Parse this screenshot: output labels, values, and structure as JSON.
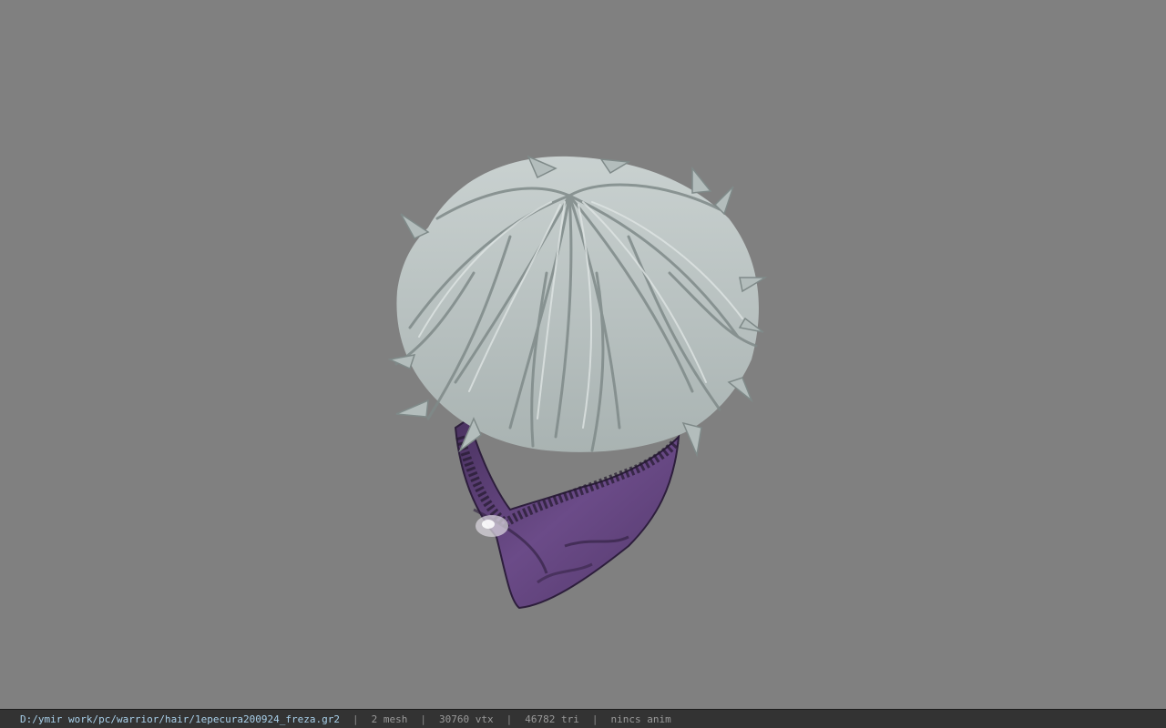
{
  "viewer": {
    "background_color": "#808080",
    "model": {
      "description_icon": "hair-model-icon",
      "hair_color": "#b8c2c1",
      "band_color": "#5a3f73"
    }
  },
  "statusbar": {
    "file_path": "D:/ymir work/pc/warrior/hair/1epecura200924_freza.gr2",
    "separator": "|",
    "mesh_count": "2 mesh",
    "vertex_count": "30760 vtx",
    "triangle_count": "46782 tri",
    "anim_status": "nincs anim"
  }
}
